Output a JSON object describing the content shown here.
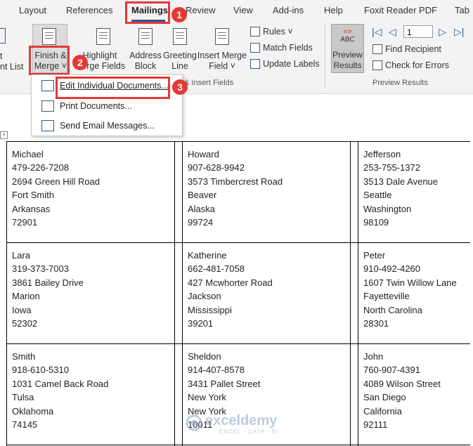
{
  "tabs": [
    "Layout",
    "References",
    "Mailings",
    "Review",
    "View",
    "Add-ins",
    "Help",
    "Foxit Reader PDF",
    "Tab"
  ],
  "ribbon": {
    "left_cut": [
      "t",
      "nt List"
    ],
    "finish_merge": [
      "Finish &",
      "Merge ˅"
    ],
    "highlight": [
      "Highlight",
      "Merge Fields"
    ],
    "address_block": [
      "Address",
      "Block"
    ],
    "greeting_line": [
      "Greeting",
      "Line"
    ],
    "insert_merge_field": [
      "Insert Merge",
      "Field ˅"
    ],
    "rules": "Rules ˅",
    "match_fields": "Match Fields",
    "update_labels": "Update Labels",
    "write_insert_label": "& Insert Fields",
    "preview_abc": "ABC",
    "preview_chevrons": "«»",
    "preview_results": [
      "Preview",
      "Results"
    ],
    "record_value": "1",
    "find_recipient": "Find Recipient",
    "check_errors": "Check for Errors",
    "preview_group_label": "Preview Results",
    "nav": [
      "|◁",
      "◁",
      "▷",
      "▷|"
    ]
  },
  "dropdown": {
    "items": [
      "Edit Individual Documents...",
      "Print Documents...",
      "Send Email Messages..."
    ]
  },
  "badges": [
    "1",
    "2",
    "3"
  ],
  "labels": [
    [
      "Michael",
      "479-226-7208",
      "2694 Green Hill Road",
      "Fort Smith",
      "Arkansas",
      "72901"
    ],
    [
      "Howard",
      "907-628-9942",
      "3573 Timbercrest Road",
      "Beaver",
      "Alaska",
      "99724"
    ],
    [
      "Jefferson",
      "253-755-1372",
      "3513 Dale Avenue",
      "Seattle",
      "Washington",
      "98109"
    ],
    [
      "Lara",
      "319-373-7003",
      "3861 Bailey Drive",
      "Marion",
      "Iowa",
      "52302"
    ],
    [
      "Katherine",
      "662-481-7058",
      "427 Mcwhorter Road",
      "Jackson",
      "Mississippi",
      "39201"
    ],
    [
      "Peter",
      "910-492-4260",
      "1607 Twin Willow Lane",
      "Fayetteville",
      "North Carolina",
      "28301"
    ],
    [
      "Smith",
      "918-610-5310",
      "1031 Camel Back Road",
      "Tulsa",
      "Oklahoma",
      "74145"
    ],
    [
      "Sheldon",
      "914-407-8578",
      "3431 Pallet Street",
      "New York",
      "New York",
      "10011"
    ],
    [
      "John",
      "760-907-4391",
      "4089 Wilson Street",
      "San Diego",
      "California",
      "92111"
    ]
  ],
  "watermark": {
    "name": "exceldemy",
    "sub": "EXCEL · DATA · BI"
  },
  "colors": {
    "accent": "#2b579a",
    "highlight": "#e53935"
  }
}
